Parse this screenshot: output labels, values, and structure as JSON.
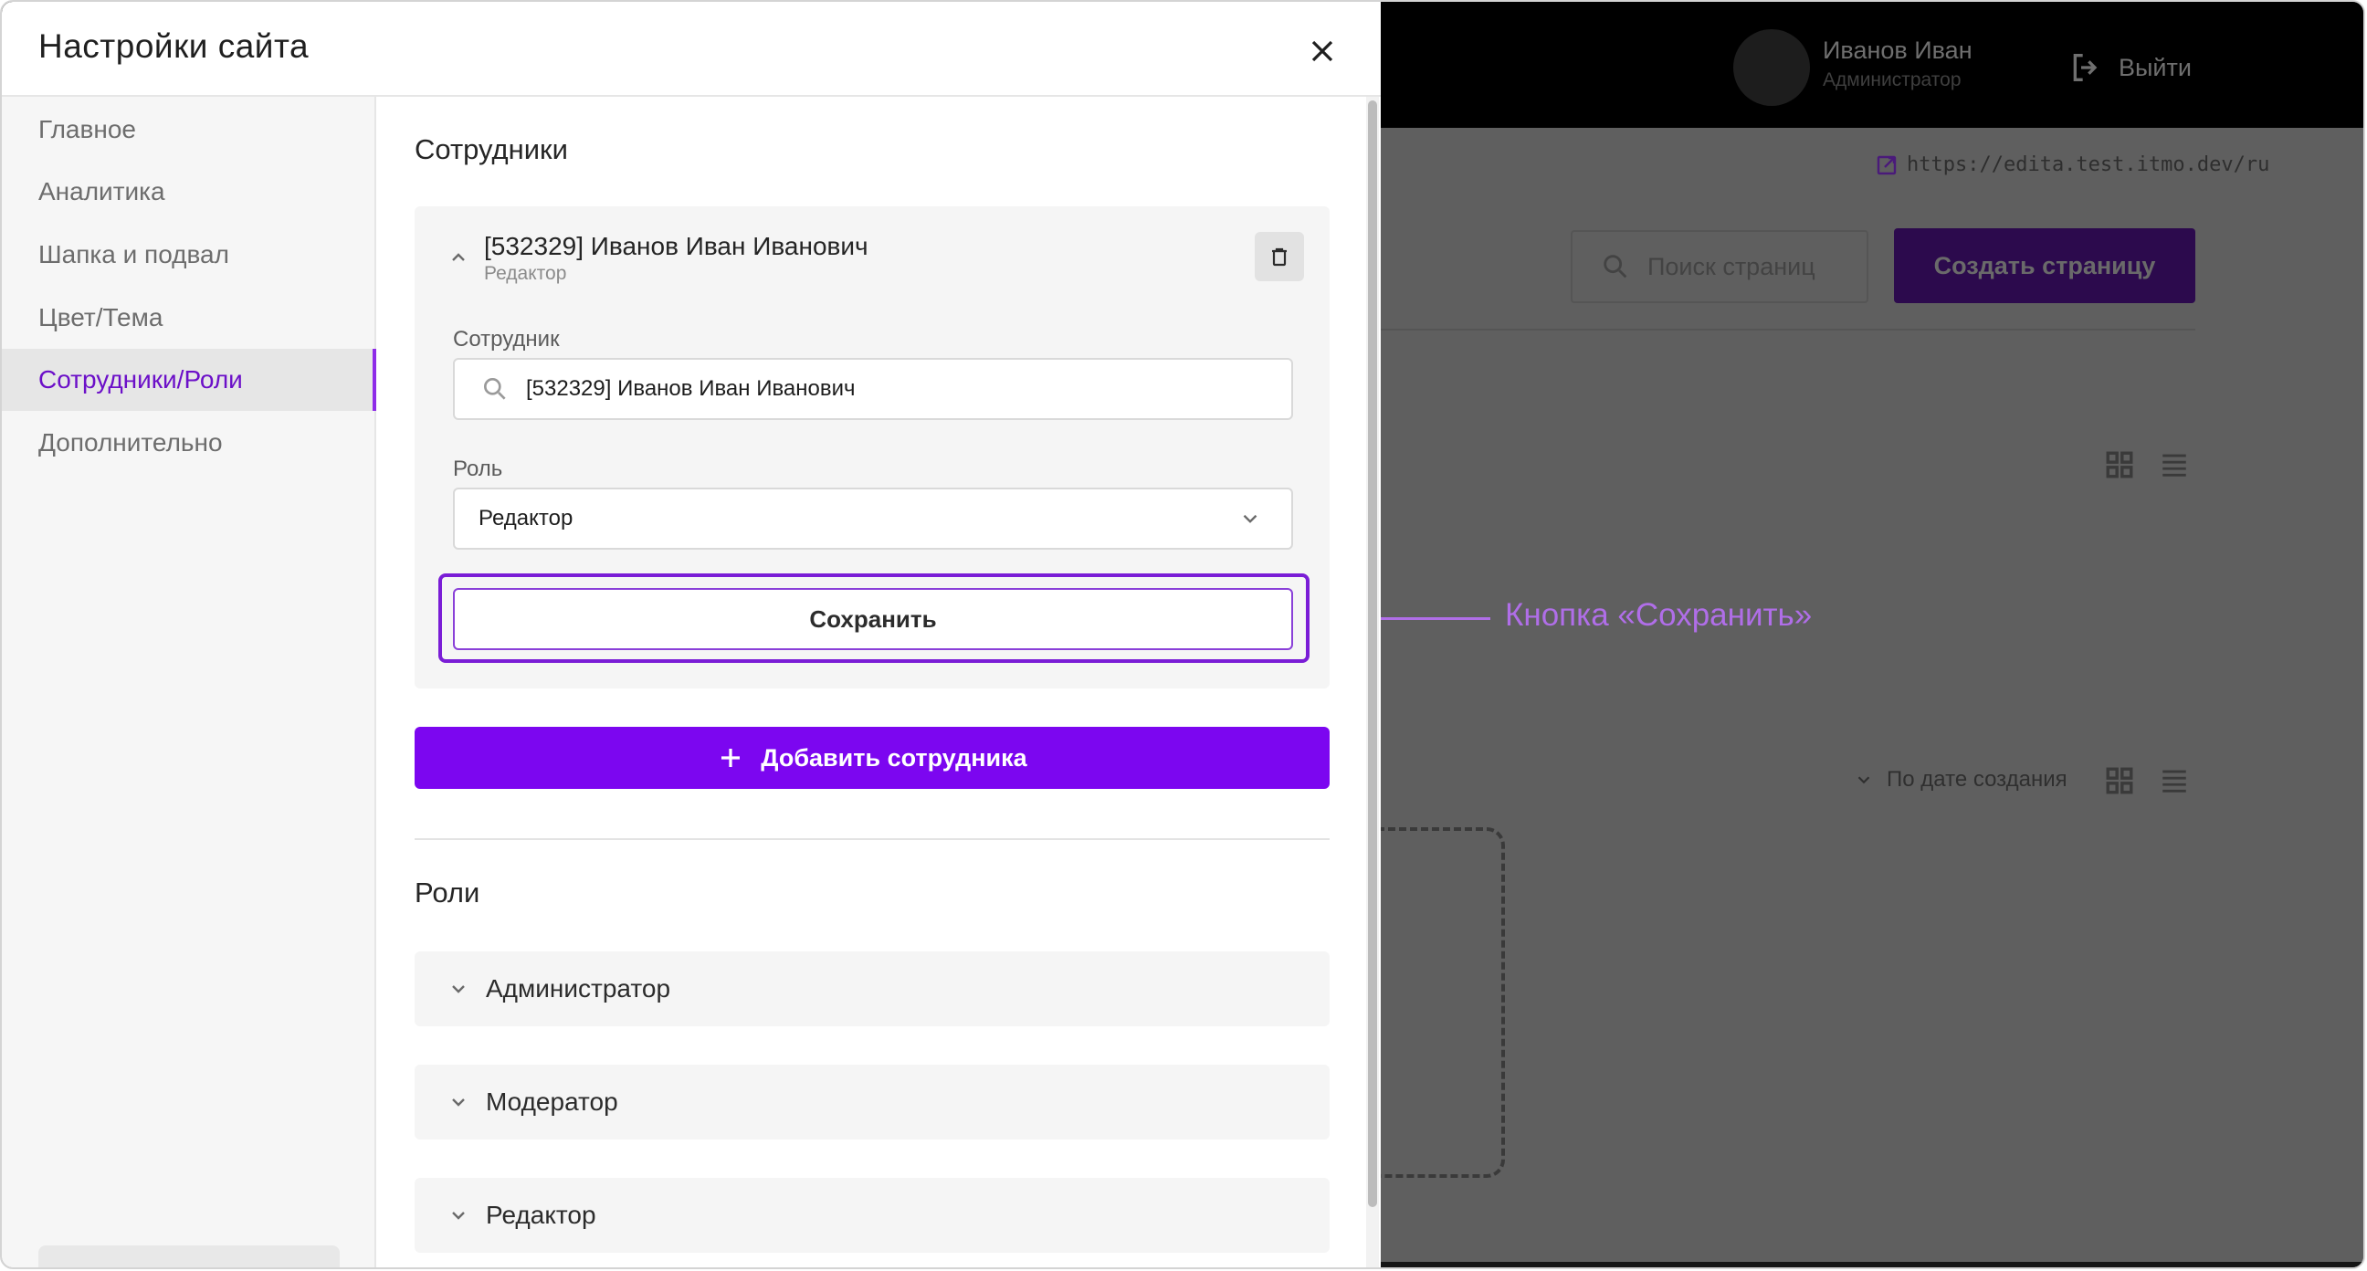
{
  "modal": {
    "title": "Настройки сайта",
    "close_icon": "close-icon"
  },
  "sidebar": {
    "items": [
      {
        "label": "Главное",
        "active": false
      },
      {
        "label": "Аналитика",
        "active": false
      },
      {
        "label": "Шапка и подвал",
        "active": false
      },
      {
        "label": "Цвет/Тема",
        "active": false
      },
      {
        "label": "Сотрудники/Роли",
        "active": true
      },
      {
        "label": "Дополнительно",
        "active": false
      }
    ]
  },
  "employees": {
    "section_title": "Сотрудники",
    "card": {
      "name": "[532329] Иванов Иван Иванович",
      "role_subtitle": "Редактор",
      "employee_label": "Сотрудник",
      "employee_value": "[532329] Иванов Иван Иванович",
      "role_label": "Роль",
      "role_value": "Редактор",
      "save_label": "Сохранить"
    },
    "add_label": "Добавить сотрудника"
  },
  "roles": {
    "section_title": "Роли",
    "items": [
      "Администратор",
      "Модератор",
      "Редактор"
    ]
  },
  "callout": {
    "text": "Кнопка «Сохранить»"
  },
  "background": {
    "user_name": "Иванов Иван",
    "user_role": "Администратор",
    "logout_label": "Выйти",
    "site_link": "https://edita.test.itmo.dev/ru",
    "search_placeholder": "Поиск страниц",
    "create_label": "Создать страницу",
    "sort_label": "По дате создания"
  },
  "colors": {
    "accent": "#7c06f0",
    "active_nav": "#6c10c8",
    "callout": "#b06ee8"
  }
}
